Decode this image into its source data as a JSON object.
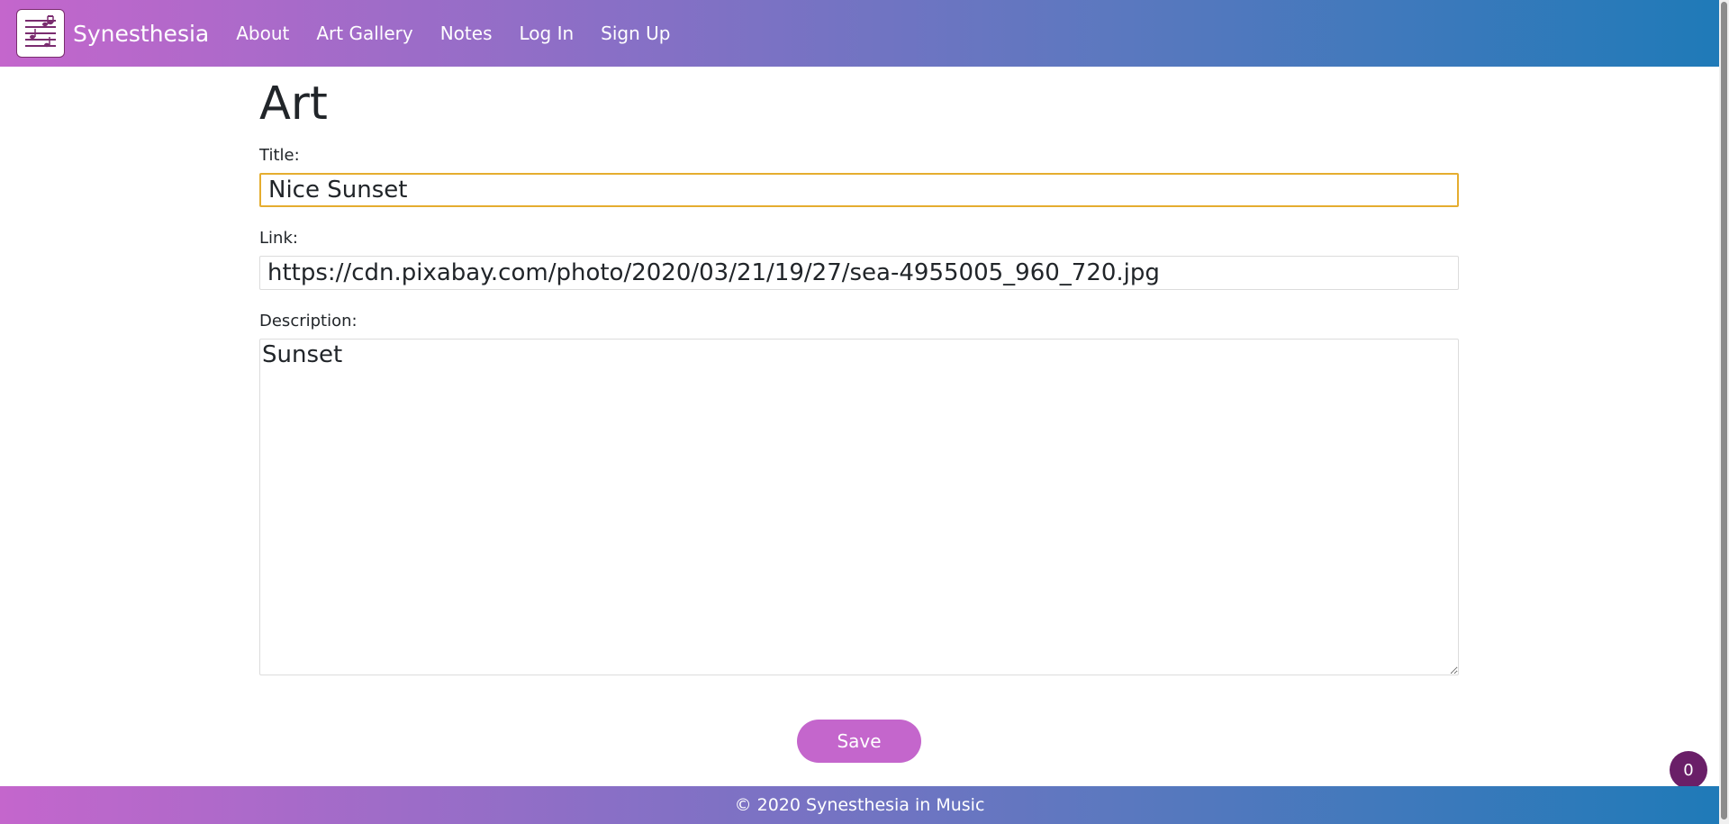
{
  "nav": {
    "brand": "Synesthesia",
    "links": [
      "About",
      "Art Gallery",
      "Notes",
      "Log In",
      "Sign Up"
    ]
  },
  "main": {
    "heading": "Art",
    "title_label": "Title:",
    "title_value": "Nice Sunset",
    "link_label": "Link:",
    "link_value": "https://cdn.pixabay.com/photo/2020/03/21/19/27/sea-4955005_960_720.jpg",
    "description_label": "Description:",
    "description_value": "Sunset",
    "save_label": "Save"
  },
  "footer": {
    "text": "© 2020 Synesthesia in Music"
  },
  "badge": {
    "count": "0"
  },
  "colors": {
    "accent": "#c466cc",
    "nav_gradient_end": "#1f7ab8",
    "focus_border": "#e5ad2f",
    "badge_bg": "#6a1f68"
  },
  "icons": {
    "logo": "sheet-music-logo-icon"
  }
}
